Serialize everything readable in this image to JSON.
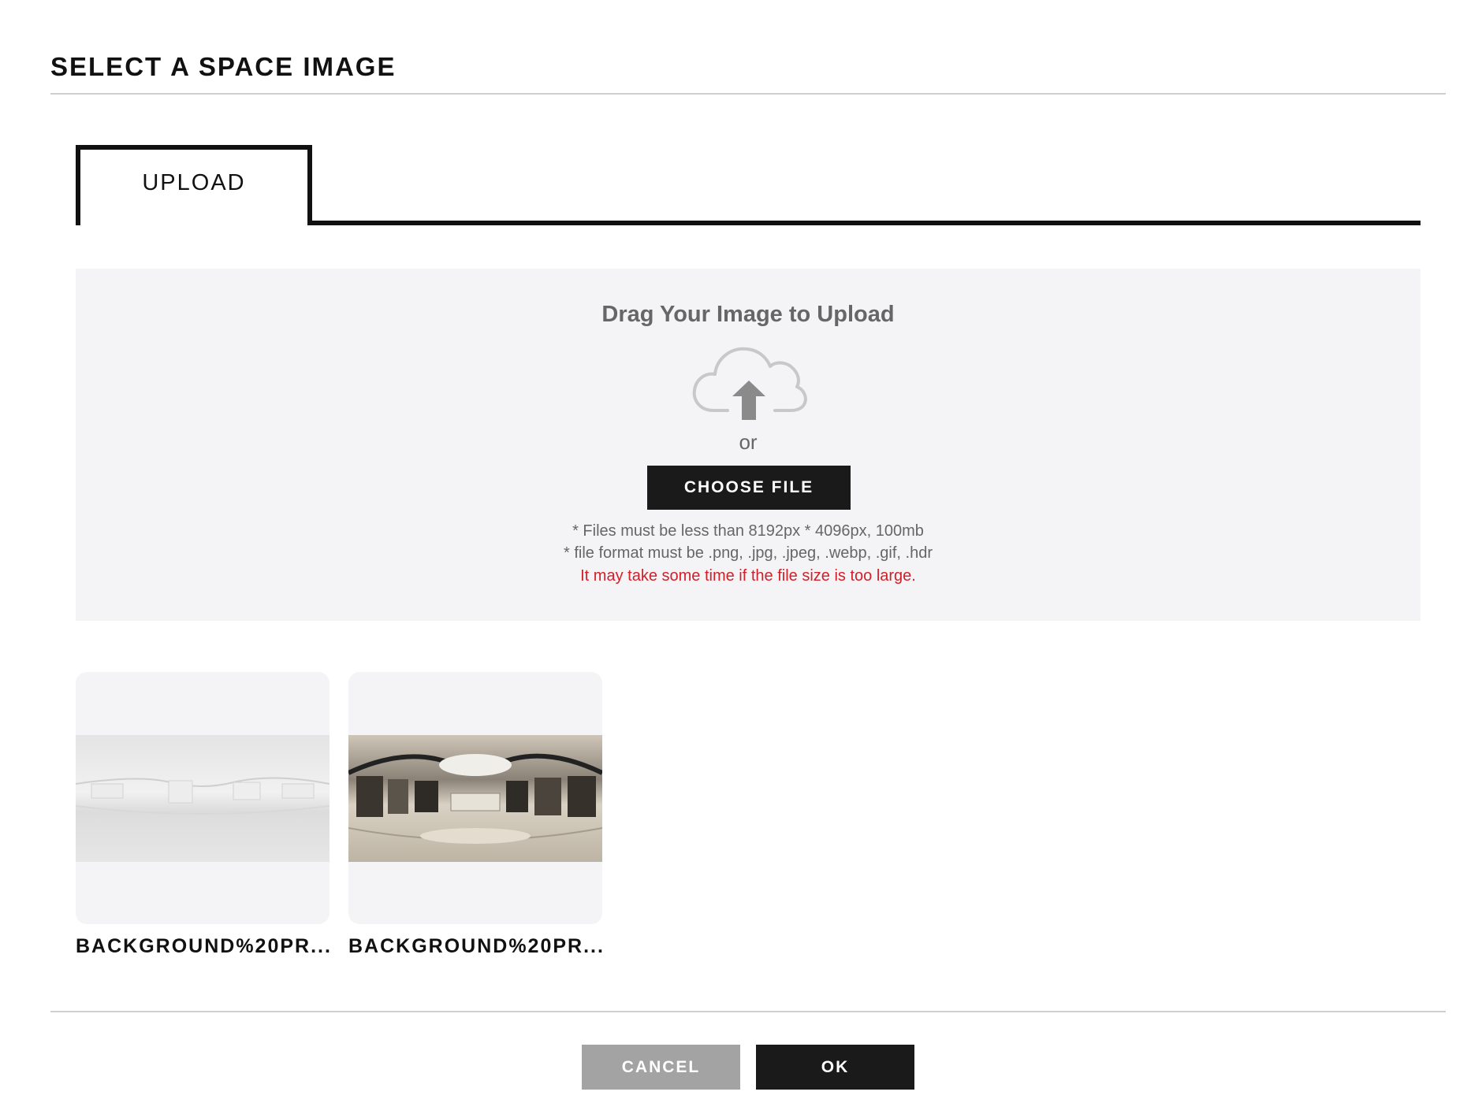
{
  "dialog": {
    "title": "SELECT A SPACE IMAGE"
  },
  "tabs": [
    {
      "label": "UPLOAD",
      "active": true
    }
  ],
  "upload": {
    "drag_text": "Drag Your Image to Upload",
    "icon": "cloud-upload-icon",
    "or_text": "or",
    "choose_button": "CHOOSE FILE",
    "note_size": "*  Files must be less than 8192px * 4096px, 100mb",
    "note_format": "*  file format must be .png, .jpg, .jpeg, .webp, .gif, .hdr",
    "warning": "It may take some time if the file size is too large.",
    "warning_color": "#d0202a"
  },
  "images": [
    {
      "name": "BACKGROUND%20PR...",
      "style": "white showroom panorama"
    },
    {
      "name": "BACKGROUND%20PR...",
      "style": "retail store panorama"
    }
  ],
  "footer": {
    "cancel_label": "CANCEL",
    "ok_label": "OK"
  },
  "colors": {
    "primary": "#1a1a1a",
    "secondary_button": "#a3a3a3",
    "panel_bg": "#f4f4f6"
  }
}
